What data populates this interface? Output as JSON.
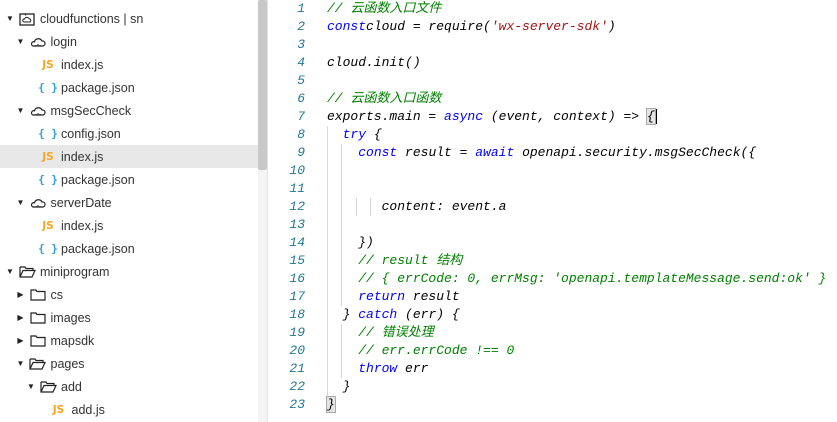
{
  "tree": [
    {
      "label": "cloudfunctions | sn",
      "level": 0,
      "arrow": "down",
      "icon": "cloud-folder"
    },
    {
      "label": "login",
      "level": 1,
      "arrow": "down",
      "icon": "cloud"
    },
    {
      "label": "index.js",
      "level": 2,
      "icon": "js"
    },
    {
      "label": "package.json",
      "level": 2,
      "icon": "json"
    },
    {
      "label": "msgSecCheck",
      "level": 1,
      "arrow": "down",
      "icon": "cloud"
    },
    {
      "label": "config.json",
      "level": 2,
      "icon": "json"
    },
    {
      "label": "index.js",
      "level": 2,
      "icon": "js",
      "selected": true
    },
    {
      "label": "package.json",
      "level": 2,
      "icon": "json"
    },
    {
      "label": "serverDate",
      "level": 1,
      "arrow": "down",
      "icon": "cloud"
    },
    {
      "label": "index.js",
      "level": 2,
      "icon": "js"
    },
    {
      "label": "package.json",
      "level": 2,
      "icon": "json"
    },
    {
      "label": "miniprogram",
      "level": 0,
      "arrow": "down",
      "icon": "folder-open"
    },
    {
      "label": "cs",
      "level": 1,
      "arrow": "right",
      "icon": "folder"
    },
    {
      "label": "images",
      "level": 1,
      "arrow": "right",
      "icon": "folder"
    },
    {
      "label": "mapsdk",
      "level": 1,
      "arrow": "right",
      "icon": "folder"
    },
    {
      "label": "pages",
      "level": 1,
      "arrow": "down",
      "icon": "folder-open"
    },
    {
      "label": "add",
      "level": 2,
      "arrow": "down",
      "icon": "folder-open"
    },
    {
      "label": "add.js",
      "level": 3,
      "icon": "js"
    }
  ],
  "icons": {
    "js": "JS",
    "json": "{ }"
  },
  "code": [
    [
      [
        "c",
        "// 云函数入口文件"
      ]
    ],
    [
      [
        "k",
        "const"
      ],
      [
        "",
        "cloud = require("
      ],
      [
        "s",
        "'wx-server-sdk'"
      ],
      [
        "",
        ")"
      ]
    ],
    [],
    [
      [
        "",
        "cloud.init()"
      ]
    ],
    [],
    [
      [
        "c",
        "// 云函数入口函数"
      ]
    ],
    [
      [
        "",
        "exports.main = "
      ],
      [
        "k",
        "async"
      ],
      [
        "",
        " (event, context) => "
      ],
      [
        "m",
        "{"
      ]
    ],
    [
      [
        "",
        "  "
      ],
      [
        "k",
        "try"
      ],
      [
        "",
        " {"
      ]
    ],
    [
      [
        "",
        "    "
      ],
      [
        "k",
        "const"
      ],
      [
        "",
        " result = "
      ],
      [
        "k",
        "await"
      ],
      [
        "",
        " openapi.security.msgSecCheck({"
      ]
    ],
    [
      [
        "",
        "    "
      ]
    ],
    [
      [
        "",
        "    "
      ]
    ],
    [
      [
        "",
        "       content: event.a"
      ]
    ],
    [
      [
        "",
        "    "
      ]
    ],
    [
      [
        "",
        "    })"
      ]
    ],
    [
      [
        "",
        "    "
      ],
      [
        "c",
        "// result 结构"
      ]
    ],
    [
      [
        "",
        "    "
      ],
      [
        "c",
        "// { errCode: 0, errMsg: 'openapi.templateMessage.send:ok' }"
      ]
    ],
    [
      [
        "",
        "    "
      ],
      [
        "k",
        "return"
      ],
      [
        "",
        " result"
      ]
    ],
    [
      [
        "",
        "  } "
      ],
      [
        "k",
        "catch"
      ],
      [
        "",
        " (err) {"
      ]
    ],
    [
      [
        "",
        "    "
      ],
      [
        "c",
        "// 错误处理"
      ]
    ],
    [
      [
        "",
        "    "
      ],
      [
        "c",
        "// err.errCode !== 0"
      ]
    ],
    [
      [
        "",
        "    "
      ],
      [
        "k",
        "throw"
      ],
      [
        "",
        " err"
      ]
    ],
    [
      [
        "",
        "  }"
      ]
    ],
    [
      [
        "m",
        "}"
      ]
    ]
  ],
  "colors": {
    "keyword": "#0000ff",
    "comment": "#008000",
    "string": "#a31515",
    "line_number": "#237893"
  }
}
